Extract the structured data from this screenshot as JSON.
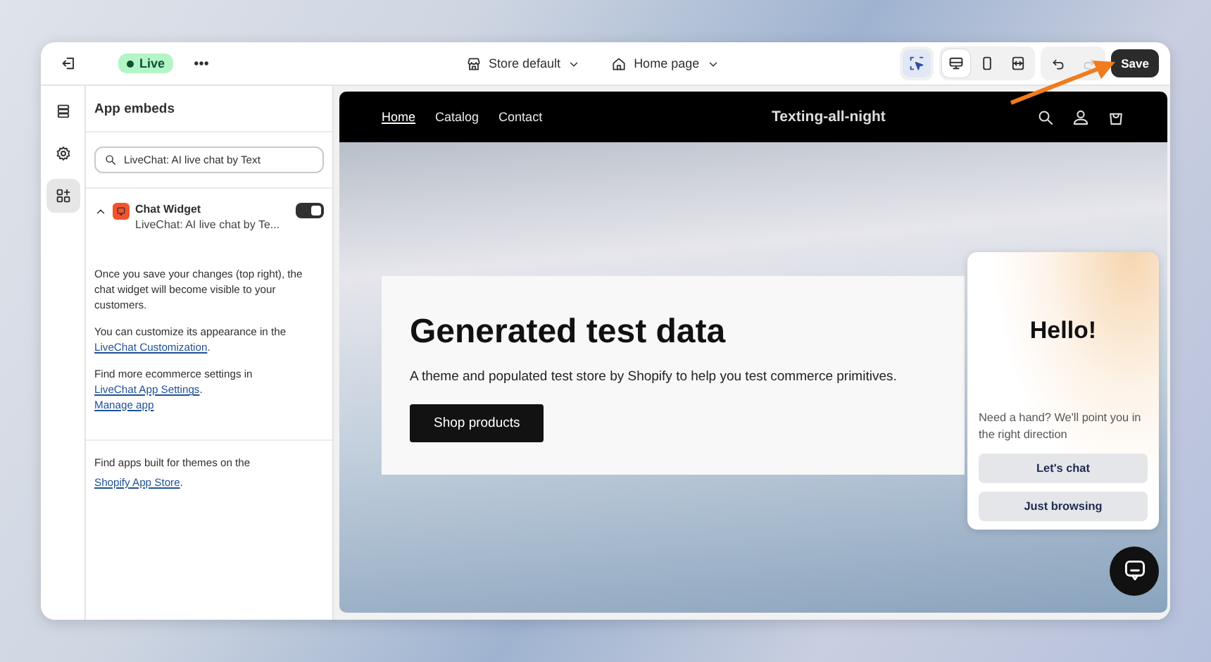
{
  "topbar": {
    "status": "Live",
    "theme": "Store default",
    "page": "Home page",
    "inspector": {
      "on": true
    },
    "views": [
      {
        "kind": "desktop",
        "selected": true
      },
      {
        "kind": "mobile",
        "selected": false
      },
      {
        "kind": "fullwidth",
        "selected": false
      }
    ],
    "redo": {
      "disabled": true
    },
    "save": "Save"
  },
  "rail": [
    {
      "kind": "sections",
      "selected": false
    },
    {
      "kind": "settings",
      "selected": false
    },
    {
      "kind": "apps",
      "selected": true
    }
  ],
  "panel": {
    "title": "App embeds",
    "search": {
      "value": "LiveChat: AI live chat by Text"
    },
    "embed": {
      "name": "Chat Widget",
      "app": "LiveChat: AI live chat by Te...",
      "expanded": true,
      "on": true
    },
    "paragraphs": [
      [
        {
          "kind": "text",
          "text": "Once you save your changes (top right), the chat widget will become visible to your customers."
        }
      ],
      [
        {
          "kind": "text",
          "text": "You can customize its appearance in the "
        },
        {
          "kind": "link",
          "text": "LiveChat Customization"
        },
        {
          "kind": "text",
          "text": "."
        }
      ],
      [
        {
          "kind": "text",
          "text": "Find more ecommerce settings in "
        },
        {
          "kind": "link",
          "text": "LiveChat App Settings"
        },
        {
          "kind": "text",
          "text": "."
        },
        {
          "kind": "break"
        },
        {
          "kind": "link",
          "text": "Manage app"
        }
      ]
    ],
    "footer": [
      {
        "kind": "text",
        "text": "Find apps built for themes on the "
      },
      {
        "kind": "link",
        "text": "Shopify App Store"
      },
      {
        "kind": "text",
        "text": "."
      }
    ]
  },
  "preview": {
    "nav": [
      {
        "label": "Home",
        "selected": true
      },
      {
        "label": "Catalog",
        "selected": false
      },
      {
        "label": "Contact",
        "selected": false
      }
    ],
    "store_name": "Texting-all-night",
    "hero": {
      "title": "Generated test data",
      "text": "A theme and populated test store by Shopify to help you test commerce primitives.",
      "button": "Shop products"
    },
    "chat": {
      "greeting": "Hello!",
      "text": "Need a hand? We'll point you in the right direction",
      "buttons": [
        "Let's chat",
        "Just browsing"
      ]
    }
  }
}
